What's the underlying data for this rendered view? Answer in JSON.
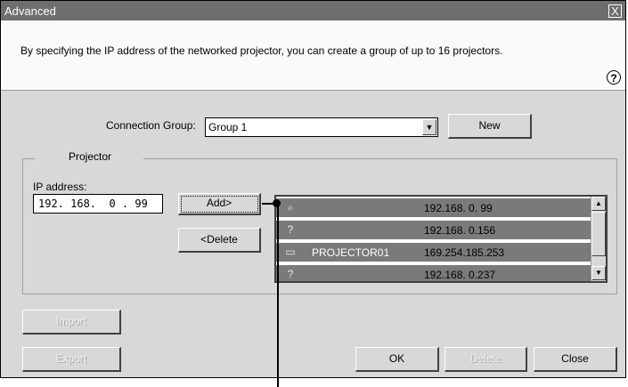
{
  "window": {
    "title": "Advanced",
    "close_label": "X"
  },
  "description": "By specifying the IP address of the networked projector, you can create a group of up to 16 projectors.",
  "help_label": "?",
  "connection_group": {
    "label": "Connection Group:",
    "value": "Group 1",
    "new_label": "New"
  },
  "projector_group": {
    "title": "Projector"
  },
  "ip_address": {
    "label": "IP address:",
    "value": "192. 168.  0 . 99"
  },
  "buttons": {
    "add": "Add>",
    "delete": "<Delete",
    "import": "Import",
    "export": "Export",
    "ok": "OK",
    "delete_bottom": "Delete",
    "close": "Close"
  },
  "projector_list": [
    {
      "icon": "search-projector-icon",
      "glyph": "⌕",
      "name": "",
      "ip": "192.168.  0. 99"
    },
    {
      "icon": "unknown-projector-icon",
      "glyph": "?",
      "name": "",
      "ip": "192.168.  0.156"
    },
    {
      "icon": "projector-icon",
      "glyph": "▭",
      "name": "PROJECTOR01",
      "ip": "169.254.185.253"
    },
    {
      "icon": "unknown-projector-icon",
      "glyph": "?",
      "name": "",
      "ip": "192.168.  0.237"
    }
  ],
  "colors": {
    "titlebar": "#6e6e6e",
    "dialog": "#d8d8d8",
    "list_row": "#7a7a7a"
  }
}
